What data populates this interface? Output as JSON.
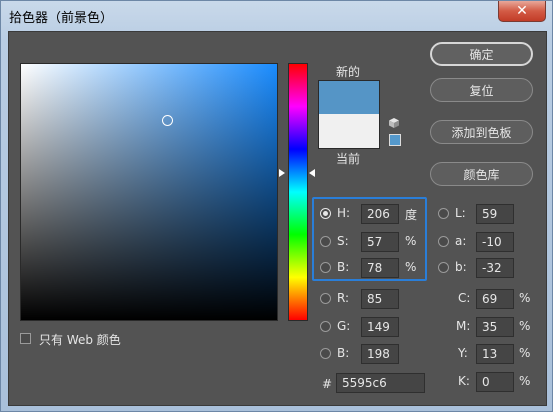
{
  "window": {
    "title": "拾色器（前景色）",
    "close_glyph": "✕"
  },
  "picker": {
    "marker": {
      "x_frac": 0.57,
      "y_frac": 0.22
    },
    "new_color": "#5595c6",
    "current_color": "#f0f0f0",
    "hue_marker_frac": 0.43,
    "gamut_swatch_color": "#5599cc"
  },
  "labels": {
    "new": "新的",
    "current": "当前"
  },
  "buttons": {
    "ok": "确定",
    "reset": "复位",
    "add_swatch": "添加到色板",
    "libraries": "颜色库"
  },
  "hsb": {
    "h": {
      "label": "H:",
      "value": "206",
      "unit": "度"
    },
    "s": {
      "label": "S:",
      "value": "57",
      "unit": "%"
    },
    "b": {
      "label": "B:",
      "value": "78",
      "unit": "%"
    }
  },
  "rgb": {
    "r": {
      "label": "R:",
      "value": "85"
    },
    "g": {
      "label": "G:",
      "value": "149"
    },
    "b": {
      "label": "B:",
      "value": "198"
    }
  },
  "lab": {
    "l": {
      "label": "L:",
      "value": "59"
    },
    "a": {
      "label": "a:",
      "value": "-10"
    },
    "b": {
      "label": "b:",
      "value": "-32"
    }
  },
  "cmyk": {
    "c": {
      "label": "C:",
      "value": "69",
      "unit": "%"
    },
    "m": {
      "label": "M:",
      "value": "35",
      "unit": "%"
    },
    "y": {
      "label": "Y:",
      "value": "13",
      "unit": "%"
    },
    "k": {
      "label": "K:",
      "value": "0",
      "unit": "%"
    }
  },
  "hex": {
    "label": "#",
    "value": "5595c6"
  },
  "web_only": {
    "label": "只有 Web 颜色"
  },
  "colors": {
    "accent_highlight": "#2a7ed8"
  }
}
